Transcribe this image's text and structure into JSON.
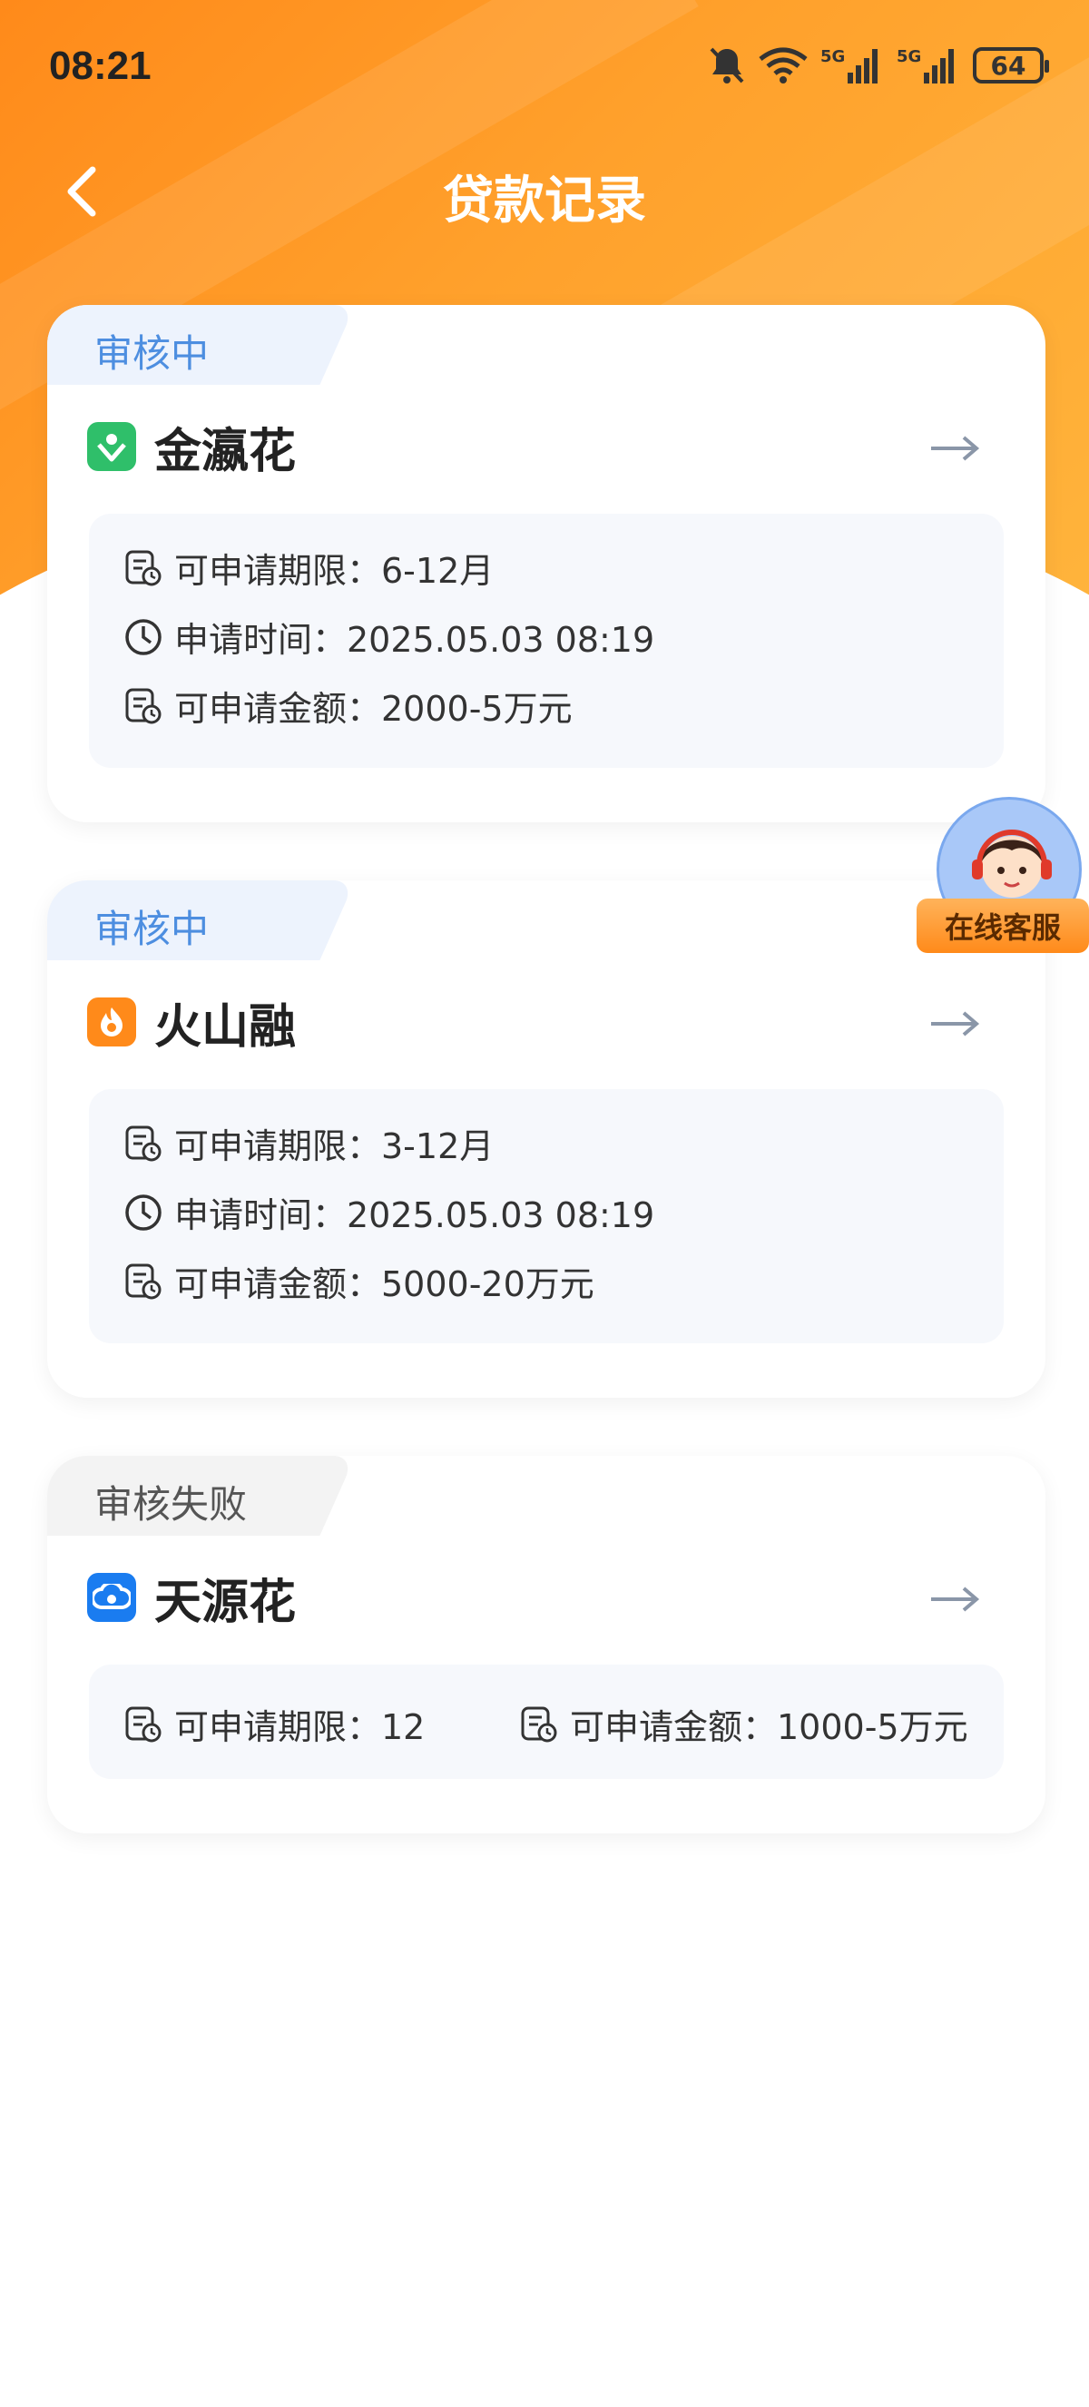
{
  "status_bar": {
    "time": "08:21",
    "battery": "64"
  },
  "nav": {
    "title": "贷款记录"
  },
  "records": [
    {
      "status": "审核中",
      "product": "金瀛花",
      "term": "可申请期限：6-12月",
      "time": "申请时间：2025.05.03 08:19",
      "amount": "可申请金额：2000-5万元"
    },
    {
      "status": "审核中",
      "product": "火山融",
      "term": "可申请期限：3-12月",
      "time": "申请时间：2025.05.03 08:19",
      "amount": "可申请金额：5000-20万元"
    },
    {
      "status": "审核失败",
      "product": "天源花",
      "term": "可申请期限：12",
      "amount": "可申请金额：1000-5万元"
    }
  ],
  "service": {
    "label": "在线客服"
  },
  "colors": {
    "header_orange": "#ff9a24",
    "status_blue": "#4d8ee0",
    "info_bg": "#f6f8fc"
  },
  "icons": [
    "back-arrow-icon",
    "mute-bell-icon",
    "wifi-icon",
    "signal-5g-icon",
    "battery-icon",
    "doc-clock-icon",
    "clock-icon",
    "right-arrow-icon"
  ]
}
